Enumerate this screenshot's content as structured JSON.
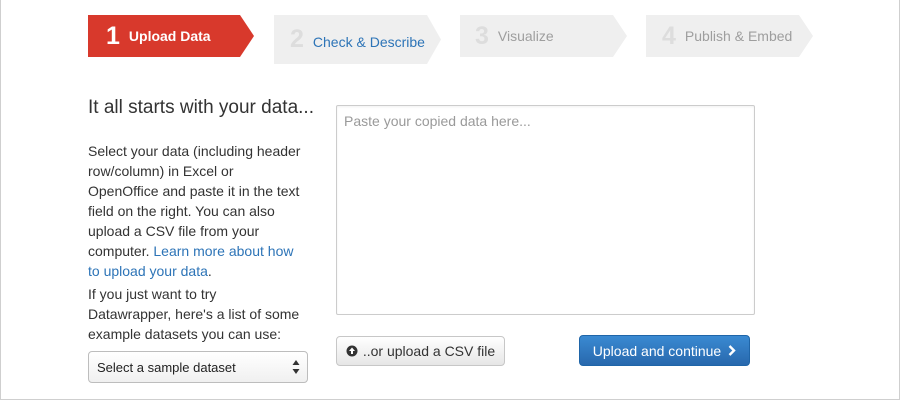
{
  "steps": [
    {
      "number": "1",
      "label": "Upload Data",
      "state": "active"
    },
    {
      "number": "2",
      "label": "Check & Describe",
      "state": "next"
    },
    {
      "number": "3",
      "label": "Visualize",
      "state": "disabled"
    },
    {
      "number": "4",
      "label": "Publish & Embed",
      "state": "disabled"
    }
  ],
  "intro": {
    "heading": "It all starts with your data...",
    "paragraph1": "Select your data (including header row/column) in Excel or OpenOffice and paste it in the text field on the right. You can also upload a CSV file from your computer.",
    "learn_more_link": "Learn more about how to upload your data",
    "paragraph1_end": ".",
    "paragraph2": "If you just want to try Datawrapper, here's a list of some example datasets you can use:"
  },
  "sample_select": {
    "selected": "Select a sample dataset",
    "icon": "updown-arrows-icon"
  },
  "data_input": {
    "placeholder": "Paste your copied data here..."
  },
  "csv_button": {
    "label": "..or upload a CSV file",
    "icon": "upload-circle-icon"
  },
  "continue_button": {
    "label": "Upload and continue",
    "icon": "chevron-right-icon"
  },
  "colors": {
    "active_step": "#d8392c",
    "inactive_step": "#efefef",
    "link": "#2d74b7",
    "primary_button": "#2868ad"
  }
}
